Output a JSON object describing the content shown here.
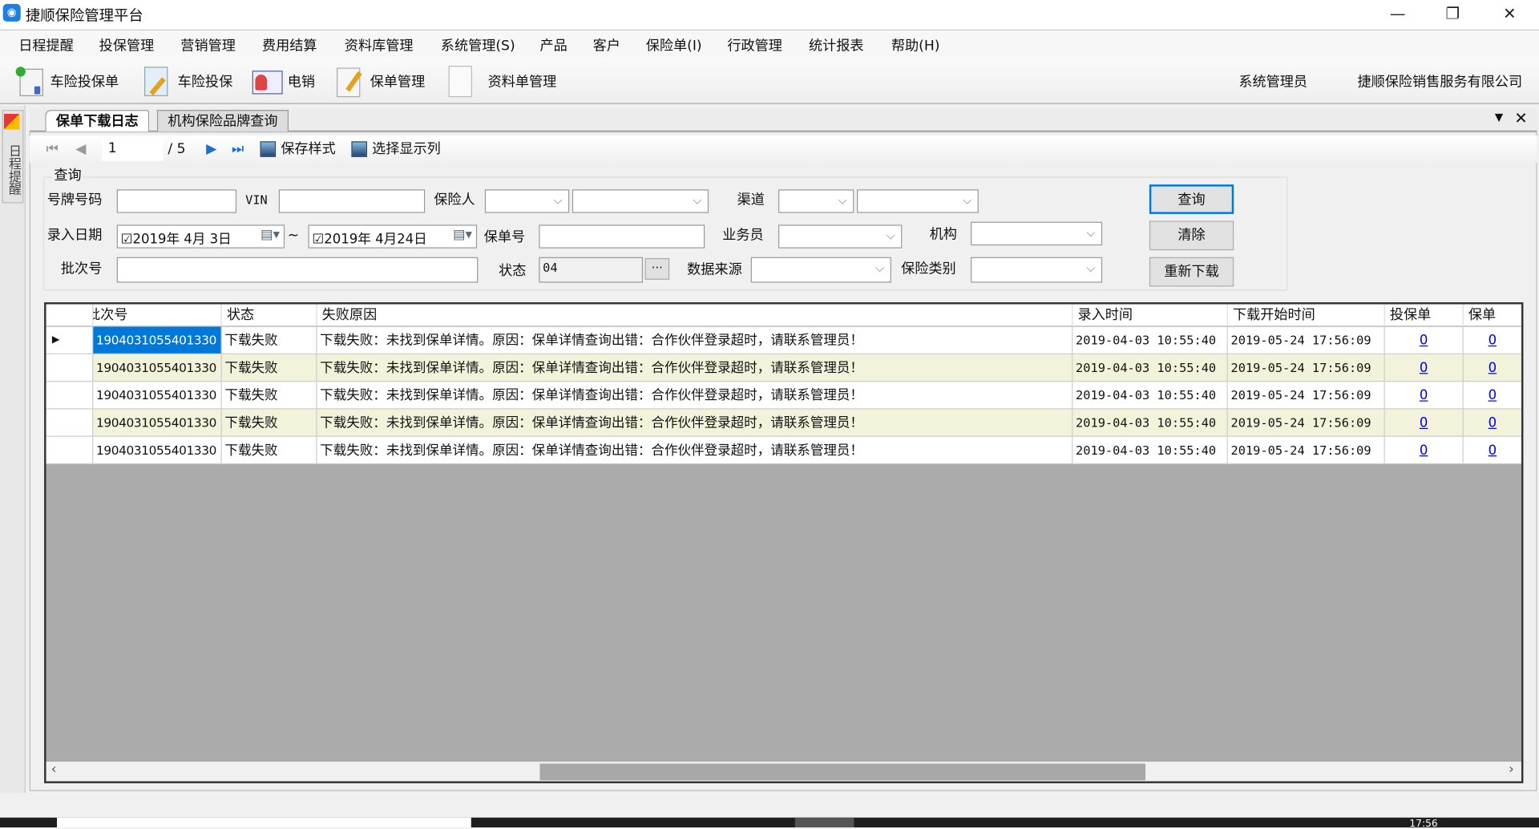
{
  "window": {
    "title": "捷顺保险管理平台",
    "controls": [
      "minimize",
      "restore",
      "close"
    ]
  },
  "menu": [
    "日程提醒",
    "投保管理",
    "营销管理",
    "费用结算",
    "资料库管理",
    "系统管理(S)",
    "产品",
    "客户",
    "保险单(I)",
    "行政管理",
    "统计报表",
    "帮助(H)"
  ],
  "toolbar": {
    "items": [
      {
        "label": "车险投保单",
        "icon": "calendar-sheet-icon"
      },
      {
        "label": "车险投保",
        "icon": "document-pencil-icon"
      },
      {
        "label": "电销",
        "icon": "contact-card-icon"
      },
      {
        "label": "保单管理",
        "icon": "checklist-pencil-icon"
      },
      {
        "label": "资料单管理",
        "icon": "blank-document-icon"
      }
    ],
    "user": "系统管理员",
    "company": "捷顺保险销售服务有限公司"
  },
  "sidebar": {
    "tab": "日程提醒"
  },
  "tabs": [
    {
      "label": "保单下载日志",
      "active": true
    },
    {
      "label": "机构保险品牌查询",
      "active": false
    }
  ],
  "pager": {
    "current": "1",
    "total": "/ 5",
    "save_style": "保存样式",
    "choose_columns": "选择显示列"
  },
  "query": {
    "group_title": "查询",
    "plate_label": "号牌号码",
    "plate_value": "",
    "vin_label": "VIN",
    "vin_value": "",
    "insured_label": "保险人",
    "channel_label": "渠道",
    "entry_date_label": "录入日期",
    "date_from": "2019年 4月 3日",
    "date_to": "2019年 4月24日",
    "date_sep": "~",
    "policy_no_label": "保单号",
    "salesman_label": "业务员",
    "org_label": "机构",
    "batch_label": "批次号",
    "status_label": "状态",
    "status_value": "04",
    "status_more": "···",
    "source_label": "数据来源",
    "ins_type_label": "保险类别",
    "search_btn": "查询",
    "clear_btn": "清除",
    "redownload_btn": "重新下载"
  },
  "grid": {
    "columns": [
      "批次号",
      "状态",
      "失败原因",
      "录入时间",
      "下载开始时间",
      "投保单",
      "保单"
    ],
    "rows": [
      [
        "1904031055401330",
        "下载失败",
        "下载失败：未找到保单详情。原因：保单详情查询出错：合作伙伴登录超时，请联系管理员！",
        "2019-04-03 10:55:40",
        "2019-05-24 17:56:09",
        "0",
        "0"
      ],
      [
        "1904031055401330",
        "下载失败",
        "下载失败：未找到保单详情。原因：保单详情查询出错：合作伙伴登录超时，请联系管理员！",
        "2019-04-03 10:55:40",
        "2019-05-24 17:56:09",
        "0",
        "0"
      ],
      [
        "1904031055401330",
        "下载失败",
        "下载失败：未找到保单详情。原因：保单详情查询出错：合作伙伴登录超时，请联系管理员！",
        "2019-04-03 10:55:40",
        "2019-05-24 17:56:09",
        "0",
        "0"
      ],
      [
        "1904031055401330",
        "下载失败",
        "下载失败：未找到保单详情。原因：保单详情查询出错：合作伙伴登录超时，请联系管理员！",
        "2019-04-03 10:55:40",
        "2019-05-24 17:56:09",
        "0",
        "0"
      ],
      [
        "1904031055401330",
        "下载失败",
        "下载失败：未找到保单详情。原因：保单详情查询出错：合作伙伴登录超时，请联系管理员！",
        "2019-04-03 10:55:40",
        "2019-05-24 17:56:09",
        "0",
        "0"
      ]
    ],
    "selected_color": "#0078d7",
    "alt_row_color": "#f3f3dc"
  },
  "taskbar": {
    "clock": "17:56"
  }
}
